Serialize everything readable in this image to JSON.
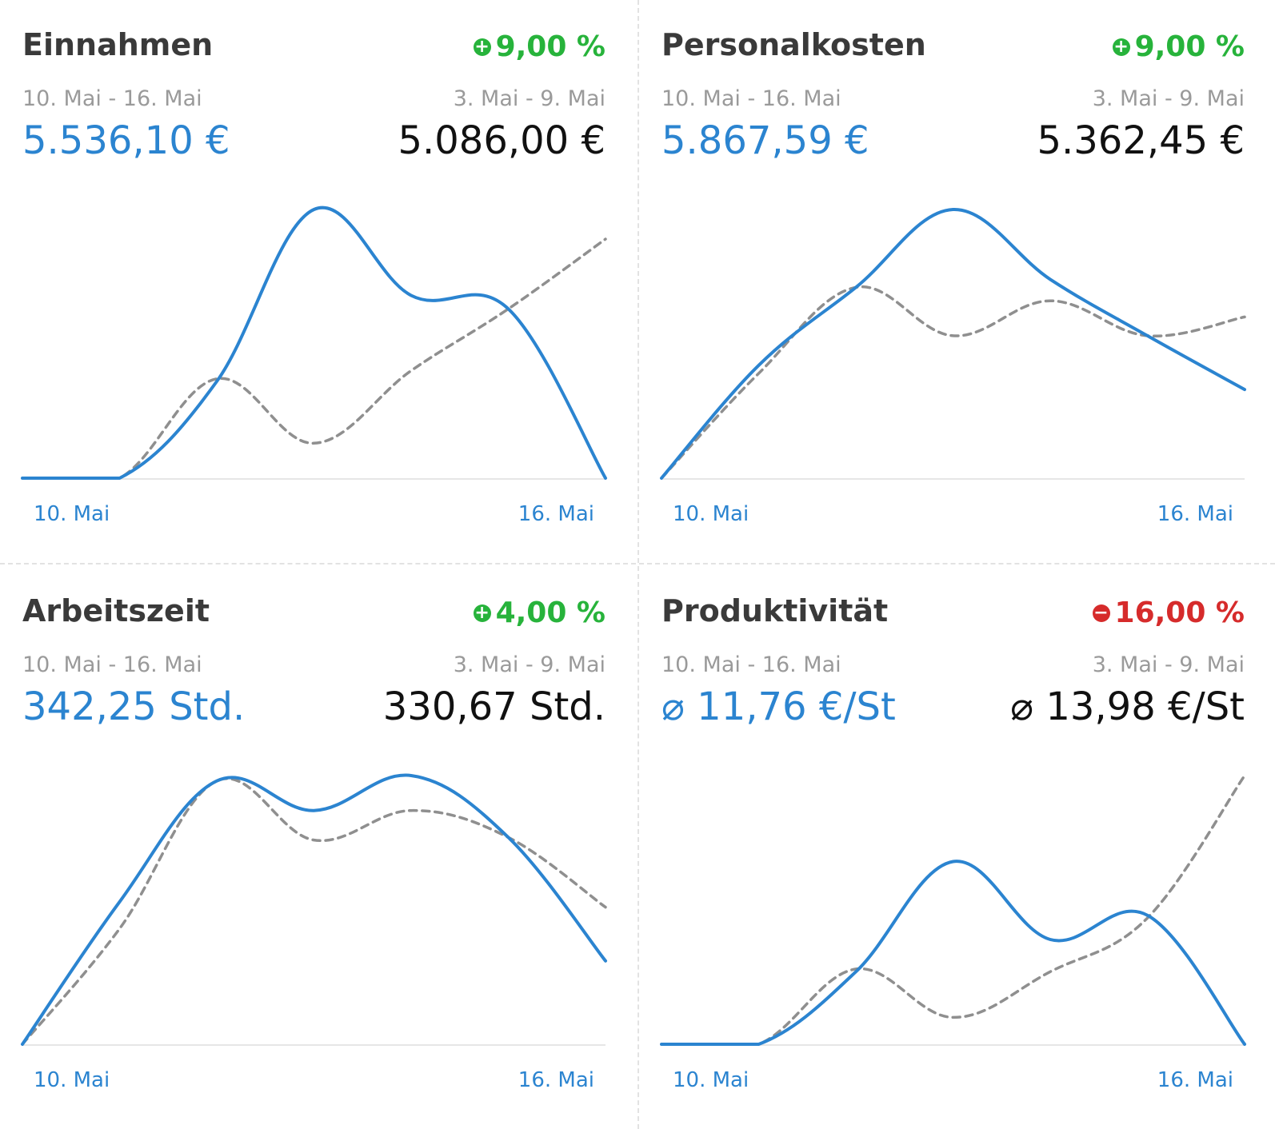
{
  "colors": {
    "current": "#2b84d0",
    "previous": "#8f8f8f",
    "positive": "#27b33b",
    "negative": "#d62b2b"
  },
  "panels": [
    {
      "title": "Einnahmen",
      "change": {
        "direction": "up",
        "icon": "plus-circle-icon",
        "sign": "+",
        "text": "9,00 %"
      },
      "current_range": "10. Mai - 16. Mai",
      "previous_range": "3. Mai - 9. Mai",
      "current_value": "5.536,10 €",
      "previous_value": "5.086,00 €",
      "x_start": "10. Mai",
      "x_end": "16. Mai"
    },
    {
      "title": "Personalkosten",
      "change": {
        "direction": "up",
        "icon": "plus-circle-icon",
        "sign": "+",
        "text": "9,00 %"
      },
      "current_range": "10. Mai - 16. Mai",
      "previous_range": "3. Mai - 9. Mai",
      "current_value": "5.867,59 €",
      "previous_value": "5.362,45 €",
      "x_start": "10. Mai",
      "x_end": "16. Mai"
    },
    {
      "title": "Arbeitszeit",
      "change": {
        "direction": "up",
        "icon": "plus-circle-icon",
        "sign": "+",
        "text": "4,00 %"
      },
      "current_range": "10. Mai - 16. Mai",
      "previous_range": "3. Mai - 9. Mai",
      "current_value": "342,25 Std.",
      "previous_value": "330,67 Std.",
      "x_start": "10. Mai",
      "x_end": "16. Mai"
    },
    {
      "title": "Produktivität",
      "change": {
        "direction": "down",
        "icon": "minus-circle-icon",
        "sign": "−",
        "text": "16,00 %"
      },
      "current_range": "10. Mai - 16. Mai",
      "previous_range": "3. Mai - 9. Mai",
      "current_value": "⌀ 11,76 €/St",
      "previous_value": "⌀ 13,98 €/St",
      "x_start": "10. Mai",
      "x_end": "16. Mai"
    }
  ],
  "chart_data": [
    {
      "type": "line",
      "title": "Einnahmen",
      "x": [
        "10. Mai",
        "",
        "",
        "",
        "",
        "",
        "16. Mai"
      ],
      "series": [
        {
          "values": [
            0,
            0,
            0.36,
            1.0,
            0.68,
            0.63,
            0
          ]
        },
        {
          "values": [
            0,
            0,
            0.37,
            0.13,
            0.4,
            0.63,
            0.89
          ],
          "dashed": true
        }
      ],
      "ylim": [
        0,
        1.0
      ]
    },
    {
      "type": "line",
      "title": "Personalkosten",
      "x": [
        "10. Mai",
        "",
        "",
        "",
        "",
        "",
        "16. Mai"
      ],
      "series": [
        {
          "values": [
            0,
            0.42,
            0.71,
            1.0,
            0.74,
            0.53,
            0.33
          ]
        },
        {
          "values": [
            0,
            0.39,
            0.71,
            0.53,
            0.66,
            0.53,
            0.6
          ],
          "dashed": true
        }
      ],
      "ylim": [
        0,
        1.0
      ]
    },
    {
      "type": "line",
      "title": "Arbeitszeit",
      "x": [
        "10. Mai",
        "",
        "",
        "",
        "",
        "",
        "16. Mai"
      ],
      "series": [
        {
          "values": [
            0,
            0.53,
            0.98,
            0.87,
            1.0,
            0.77,
            0.31
          ]
        },
        {
          "values": [
            0,
            0.43,
            0.98,
            0.76,
            0.87,
            0.77,
            0.51
          ],
          "dashed": true
        }
      ],
      "ylim": [
        0,
        1.0
      ]
    },
    {
      "type": "line",
      "title": "Produktivität",
      "x": [
        "10. Mai",
        "",
        "",
        "",
        "",
        "",
        "16. Mai"
      ],
      "series": [
        {
          "values": [
            0,
            0,
            0.27,
            0.68,
            0.39,
            0.48,
            0
          ]
        },
        {
          "values": [
            0,
            0,
            0.28,
            0.1,
            0.27,
            0.47,
            1.0
          ],
          "dashed": true
        }
      ],
      "ylim": [
        0,
        1.0
      ]
    }
  ]
}
